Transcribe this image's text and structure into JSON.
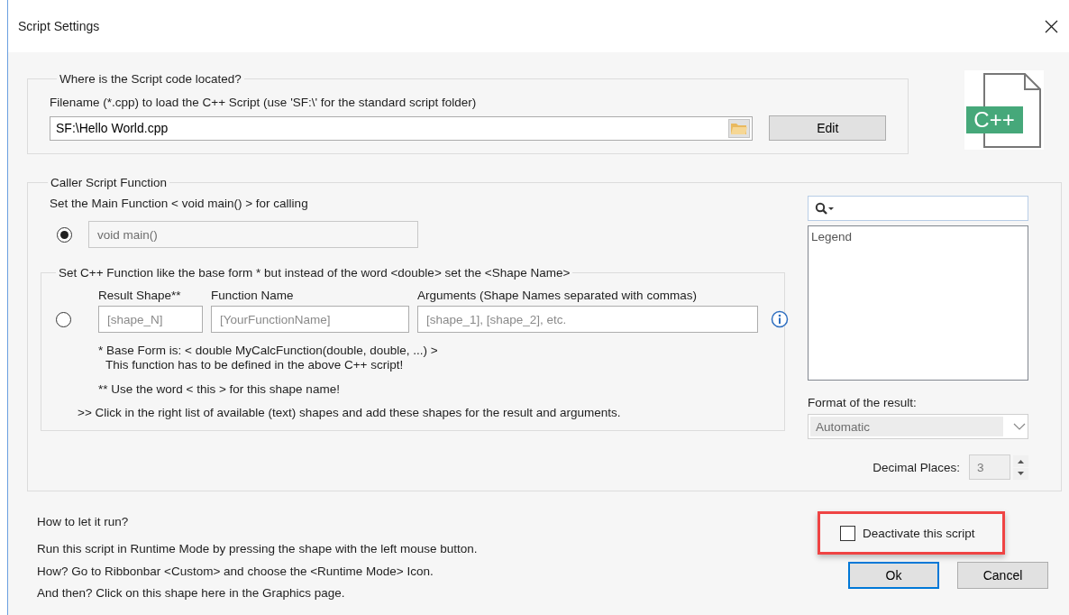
{
  "window": {
    "title": "Script Settings"
  },
  "location": {
    "legend": "Where is the Script code located?",
    "filename_label": "Filename (*.cpp) to load the C++ Script (use 'SF:\\' for the standard script folder)",
    "filename": "SF:\\Hello World.cpp",
    "edit_button": "Edit"
  },
  "file_badge": "C++",
  "caller": {
    "legend": "Caller Script Function",
    "main_label": "Set the Main Function < void main() > for calling",
    "main_option": {
      "selected": true,
      "value": "void main()",
      "disabled": true
    },
    "custom_option": {
      "legend": "Set C++ Function like the base form *  but instead of the word <double> set the <Shape Name>",
      "selected": false,
      "fields": [
        {
          "label": "Result Shape**",
          "placeholder": "[shape_N]"
        },
        {
          "label": "Function Name",
          "placeholder": "[YourFunctionName]"
        },
        {
          "label": "Arguments (Shape Names separated with commas)",
          "placeholder": "[shape_1], [shape_2], etc."
        }
      ],
      "notes": [
        "* Base Form is: < double MyCalcFunction(double, double, ...) >",
        "This function has to be defined in the above C++ script!",
        "** Use the word < this > for this shape name!"
      ],
      "hint": ">> Click in the right list of available (text) shapes and add these shapes for the result and arguments."
    },
    "shape_list": {
      "items": [
        "Legend"
      ]
    },
    "format_label": "Format of the result:",
    "format": {
      "value": "Automatic",
      "disabled": true
    },
    "decimal_label": "Decimal Places:",
    "decimal": {
      "value": "3",
      "disabled": true
    }
  },
  "help": {
    "title": "How to let it run?",
    "lines": [
      "Run this script in Runtime Mode by pressing the shape with the left mouse button.",
      "How? Go to Ribbonbar <Custom> and choose the <Runtime Mode> Icon.",
      "And then? Click on this shape here in the Graphics page."
    ]
  },
  "deactivate": {
    "label": "Deactivate this script",
    "checked": false,
    "highlighted": true
  },
  "buttons": [
    {
      "label": "Ok",
      "focused": true
    },
    {
      "label": "Cancel",
      "focused": false
    }
  ]
}
